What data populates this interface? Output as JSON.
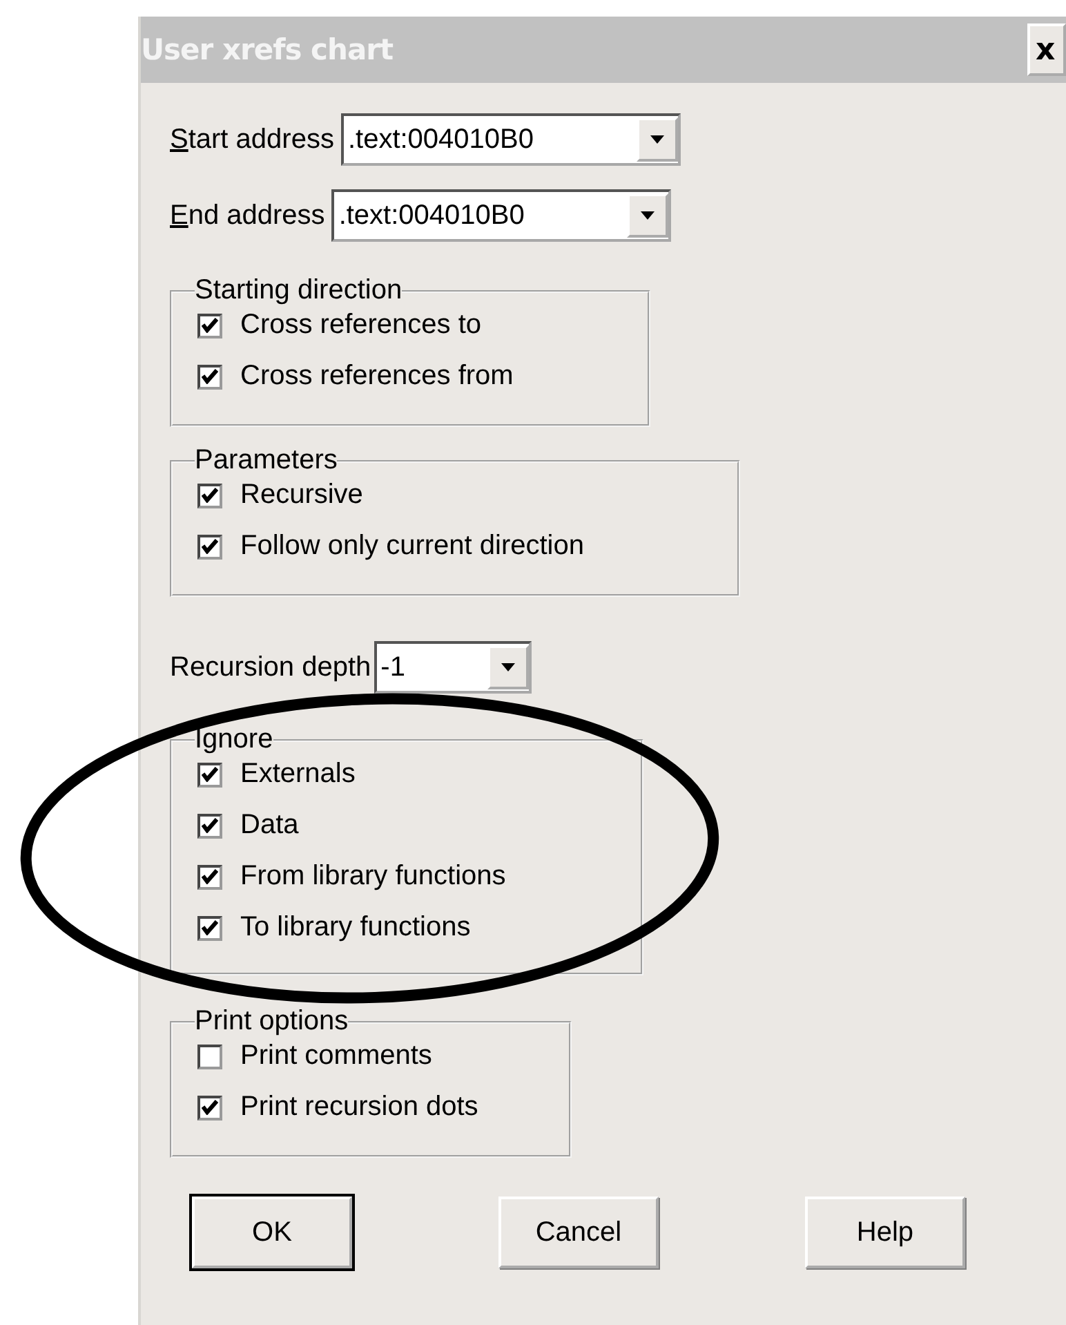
{
  "window": {
    "title": "User xrefs chart",
    "close": "x"
  },
  "address_fields": [
    {
      "label": "Start address",
      "value": ".text:004010B0"
    },
    {
      "label": "End address",
      "value": ".text:004010B0"
    }
  ],
  "groups_top": [
    {
      "title": "Starting direction",
      "items": [
        {
          "label": "Cross references to",
          "checked": true
        },
        {
          "label": "Cross references from",
          "checked": true
        }
      ]
    },
    {
      "title": "Parameters",
      "items": [
        {
          "label": "Recursive",
          "checked": true
        },
        {
          "label": "Follow only current direction",
          "checked": true
        }
      ]
    }
  ],
  "recursion_depth": {
    "label": "Recursion depth",
    "value": "-1"
  },
  "groups_bottom": [
    {
      "title": "Ignore",
      "items": [
        {
          "label": "Externals",
          "checked": true
        },
        {
          "label": "Data",
          "checked": true
        },
        {
          "label": "From library functions",
          "checked": true
        },
        {
          "label": "To library functions",
          "checked": true
        }
      ]
    },
    {
      "title": "Print options",
      "items": [
        {
          "label": "Print comments",
          "checked": false
        },
        {
          "label": "Print recursion dots",
          "checked": true
        }
      ]
    }
  ],
  "buttons": [
    {
      "label": "OK",
      "default": true
    },
    {
      "label": "Cancel",
      "default": false
    },
    {
      "label": "Help",
      "default": false
    }
  ]
}
